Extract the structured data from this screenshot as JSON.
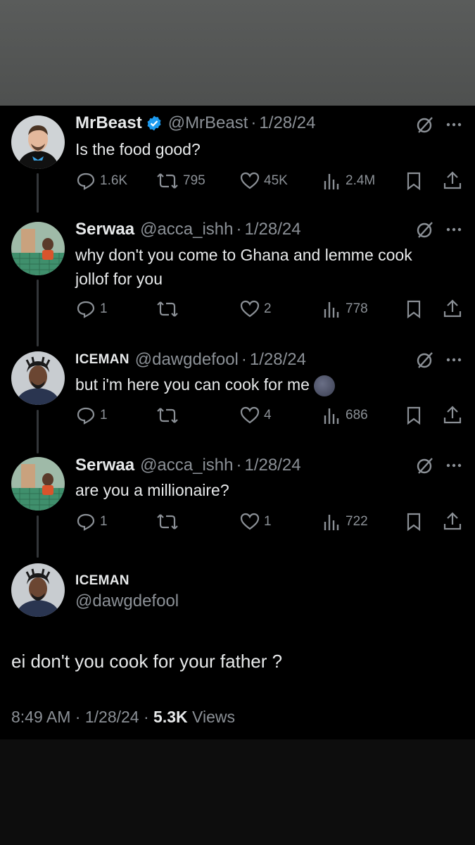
{
  "colors": {
    "background": "#000000",
    "text": "#e7e9ea",
    "muted": "#8b9096",
    "verified": "#1d9bf0"
  },
  "tweets": [
    {
      "name": "MrBeast",
      "handle": "@MrBeast",
      "separator": "·",
      "date": "1/28/24",
      "verified": true,
      "text": "Is the food good?",
      "replies": "1.6K",
      "retweets": "795",
      "likes": "45K",
      "views": "2.4M"
    },
    {
      "name": "Serwaa",
      "handle": "@acca_ishh",
      "separator": "·",
      "date": "1/28/24",
      "text": "why don't you come to Ghana and lemme cook jollof for you",
      "replies": "1",
      "retweets": "",
      "likes": "2",
      "views": "778"
    },
    {
      "name": "ICEMAN",
      "handle": "@dawgdefool",
      "separator": "·",
      "date": "1/28/24",
      "text": "but i'm here you can cook for me",
      "emoji": "new-moon-face-emoji",
      "replies": "1",
      "retweets": "",
      "likes": "4",
      "views": "686"
    },
    {
      "name": "Serwaa",
      "handle": "@acca_ishh",
      "separator": "·",
      "date": "1/28/24",
      "text": "are you a millionaire?",
      "replies": "1",
      "retweets": "",
      "likes": "1",
      "views": "722"
    }
  ],
  "main_tweet": {
    "name": "ICEMAN",
    "handle": "@dawgdefool",
    "text": "ei don't you cook for your father ?",
    "time": "8:49 AM",
    "separator1": "·",
    "date": "1/28/24",
    "separator2": "·",
    "views_count": "5.3K",
    "views_label": "Views"
  },
  "icons": [
    "reply-icon",
    "retweet-icon",
    "like-icon",
    "views-icon",
    "bookmark-icon",
    "share-icon",
    "grok-icon",
    "more-icon",
    "verified-badge-icon"
  ]
}
